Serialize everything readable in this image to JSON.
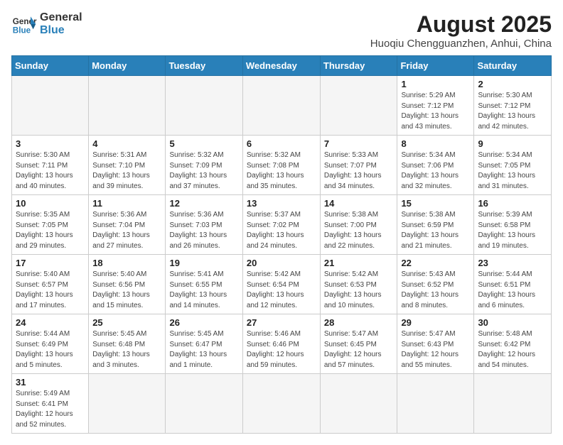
{
  "header": {
    "logo_general": "General",
    "logo_blue": "Blue",
    "month_year": "August 2025",
    "location": "Huoqiu Chengguanzhen, Anhui, China"
  },
  "weekdays": [
    "Sunday",
    "Monday",
    "Tuesday",
    "Wednesday",
    "Thursday",
    "Friday",
    "Saturday"
  ],
  "weeks": [
    [
      {
        "day": "",
        "info": ""
      },
      {
        "day": "",
        "info": ""
      },
      {
        "day": "",
        "info": ""
      },
      {
        "day": "",
        "info": ""
      },
      {
        "day": "",
        "info": ""
      },
      {
        "day": "1",
        "info": "Sunrise: 5:29 AM\nSunset: 7:12 PM\nDaylight: 13 hours and 43 minutes."
      },
      {
        "day": "2",
        "info": "Sunrise: 5:30 AM\nSunset: 7:12 PM\nDaylight: 13 hours and 42 minutes."
      }
    ],
    [
      {
        "day": "3",
        "info": "Sunrise: 5:30 AM\nSunset: 7:11 PM\nDaylight: 13 hours and 40 minutes."
      },
      {
        "day": "4",
        "info": "Sunrise: 5:31 AM\nSunset: 7:10 PM\nDaylight: 13 hours and 39 minutes."
      },
      {
        "day": "5",
        "info": "Sunrise: 5:32 AM\nSunset: 7:09 PM\nDaylight: 13 hours and 37 minutes."
      },
      {
        "day": "6",
        "info": "Sunrise: 5:32 AM\nSunset: 7:08 PM\nDaylight: 13 hours and 35 minutes."
      },
      {
        "day": "7",
        "info": "Sunrise: 5:33 AM\nSunset: 7:07 PM\nDaylight: 13 hours and 34 minutes."
      },
      {
        "day": "8",
        "info": "Sunrise: 5:34 AM\nSunset: 7:06 PM\nDaylight: 13 hours and 32 minutes."
      },
      {
        "day": "9",
        "info": "Sunrise: 5:34 AM\nSunset: 7:05 PM\nDaylight: 13 hours and 31 minutes."
      }
    ],
    [
      {
        "day": "10",
        "info": "Sunrise: 5:35 AM\nSunset: 7:05 PM\nDaylight: 13 hours and 29 minutes."
      },
      {
        "day": "11",
        "info": "Sunrise: 5:36 AM\nSunset: 7:04 PM\nDaylight: 13 hours and 27 minutes."
      },
      {
        "day": "12",
        "info": "Sunrise: 5:36 AM\nSunset: 7:03 PM\nDaylight: 13 hours and 26 minutes."
      },
      {
        "day": "13",
        "info": "Sunrise: 5:37 AM\nSunset: 7:02 PM\nDaylight: 13 hours and 24 minutes."
      },
      {
        "day": "14",
        "info": "Sunrise: 5:38 AM\nSunset: 7:00 PM\nDaylight: 13 hours and 22 minutes."
      },
      {
        "day": "15",
        "info": "Sunrise: 5:38 AM\nSunset: 6:59 PM\nDaylight: 13 hours and 21 minutes."
      },
      {
        "day": "16",
        "info": "Sunrise: 5:39 AM\nSunset: 6:58 PM\nDaylight: 13 hours and 19 minutes."
      }
    ],
    [
      {
        "day": "17",
        "info": "Sunrise: 5:40 AM\nSunset: 6:57 PM\nDaylight: 13 hours and 17 minutes."
      },
      {
        "day": "18",
        "info": "Sunrise: 5:40 AM\nSunset: 6:56 PM\nDaylight: 13 hours and 15 minutes."
      },
      {
        "day": "19",
        "info": "Sunrise: 5:41 AM\nSunset: 6:55 PM\nDaylight: 13 hours and 14 minutes."
      },
      {
        "day": "20",
        "info": "Sunrise: 5:42 AM\nSunset: 6:54 PM\nDaylight: 13 hours and 12 minutes."
      },
      {
        "day": "21",
        "info": "Sunrise: 5:42 AM\nSunset: 6:53 PM\nDaylight: 13 hours and 10 minutes."
      },
      {
        "day": "22",
        "info": "Sunrise: 5:43 AM\nSunset: 6:52 PM\nDaylight: 13 hours and 8 minutes."
      },
      {
        "day": "23",
        "info": "Sunrise: 5:44 AM\nSunset: 6:51 PM\nDaylight: 13 hours and 6 minutes."
      }
    ],
    [
      {
        "day": "24",
        "info": "Sunrise: 5:44 AM\nSunset: 6:49 PM\nDaylight: 13 hours and 5 minutes."
      },
      {
        "day": "25",
        "info": "Sunrise: 5:45 AM\nSunset: 6:48 PM\nDaylight: 13 hours and 3 minutes."
      },
      {
        "day": "26",
        "info": "Sunrise: 5:45 AM\nSunset: 6:47 PM\nDaylight: 13 hours and 1 minute."
      },
      {
        "day": "27",
        "info": "Sunrise: 5:46 AM\nSunset: 6:46 PM\nDaylight: 12 hours and 59 minutes."
      },
      {
        "day": "28",
        "info": "Sunrise: 5:47 AM\nSunset: 6:45 PM\nDaylight: 12 hours and 57 minutes."
      },
      {
        "day": "29",
        "info": "Sunrise: 5:47 AM\nSunset: 6:43 PM\nDaylight: 12 hours and 55 minutes."
      },
      {
        "day": "30",
        "info": "Sunrise: 5:48 AM\nSunset: 6:42 PM\nDaylight: 12 hours and 54 minutes."
      }
    ],
    [
      {
        "day": "31",
        "info": "Sunrise: 5:49 AM\nSunset: 6:41 PM\nDaylight: 12 hours and 52 minutes."
      },
      {
        "day": "",
        "info": ""
      },
      {
        "day": "",
        "info": ""
      },
      {
        "day": "",
        "info": ""
      },
      {
        "day": "",
        "info": ""
      },
      {
        "day": "",
        "info": ""
      },
      {
        "day": "",
        "info": ""
      }
    ]
  ]
}
